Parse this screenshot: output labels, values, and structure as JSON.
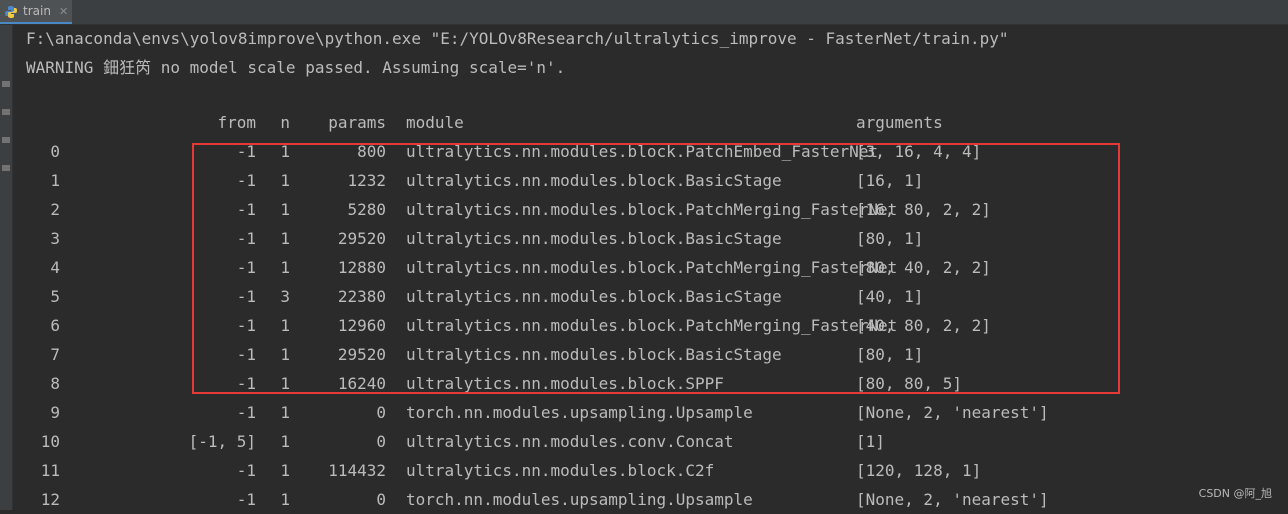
{
  "tab": {
    "label": "train",
    "icon": "python-icon",
    "close_glyph": "✕"
  },
  "console": {
    "command_line": "F:\\anaconda\\envs\\yolov8improve\\python.exe \"E:/YOLOv8Research/ultralytics_improve - FasterNet/train.py\"",
    "warning_line": "WARNING 鈿狅笍 no model scale passed. Assuming scale='n'.",
    "headers": {
      "from": "from",
      "n": "n",
      "params": "params",
      "module": "module",
      "arguments": "arguments"
    },
    "rows": [
      {
        "idx": "0",
        "from": "-1",
        "n": "1",
        "params": "800",
        "module": "ultralytics.nn.modules.block.PatchEmbed_FasterNet",
        "arguments": "[3, 16, 4, 4]"
      },
      {
        "idx": "1",
        "from": "-1",
        "n": "1",
        "params": "1232",
        "module": "ultralytics.nn.modules.block.BasicStage",
        "arguments": "[16, 1]"
      },
      {
        "idx": "2",
        "from": "-1",
        "n": "1",
        "params": "5280",
        "module": "ultralytics.nn.modules.block.PatchMerging_FasterNet",
        "arguments": "[16, 80, 2, 2]"
      },
      {
        "idx": "3",
        "from": "-1",
        "n": "1",
        "params": "29520",
        "module": "ultralytics.nn.modules.block.BasicStage",
        "arguments": "[80, 1]"
      },
      {
        "idx": "4",
        "from": "-1",
        "n": "1",
        "params": "12880",
        "module": "ultralytics.nn.modules.block.PatchMerging_FasterNet",
        "arguments": "[80, 40, 2, 2]"
      },
      {
        "idx": "5",
        "from": "-1",
        "n": "3",
        "params": "22380",
        "module": "ultralytics.nn.modules.block.BasicStage",
        "arguments": "[40, 1]"
      },
      {
        "idx": "6",
        "from": "-1",
        "n": "1",
        "params": "12960",
        "module": "ultralytics.nn.modules.block.PatchMerging_FasterNet",
        "arguments": "[40, 80, 2, 2]"
      },
      {
        "idx": "7",
        "from": "-1",
        "n": "1",
        "params": "29520",
        "module": "ultralytics.nn.modules.block.BasicStage",
        "arguments": "[80, 1]"
      },
      {
        "idx": "8",
        "from": "-1",
        "n": "1",
        "params": "16240",
        "module": "ultralytics.nn.modules.block.SPPF",
        "arguments": "[80, 80, 5]"
      },
      {
        "idx": "9",
        "from": "-1",
        "n": "1",
        "params": "0",
        "module": "torch.nn.modules.upsampling.Upsample",
        "arguments": "[None, 2, 'nearest']"
      },
      {
        "idx": "10",
        "from": "[-1, 5]",
        "n": "1",
        "params": "0",
        "module": "ultralytics.nn.modules.conv.Concat",
        "arguments": "[1]"
      },
      {
        "idx": "11",
        "from": "-1",
        "n": "1",
        "params": "114432",
        "module": "ultralytics.nn.modules.block.C2f",
        "arguments": "[120, 128, 1]"
      },
      {
        "idx": "12",
        "from": "-1",
        "n": "1",
        "params": "0",
        "module": "torch.nn.modules.upsampling.Upsample",
        "arguments": "[None, 2, 'nearest']"
      }
    ]
  },
  "highlight": {
    "color": "#e53935"
  },
  "watermark": "CSDN @阿_旭"
}
